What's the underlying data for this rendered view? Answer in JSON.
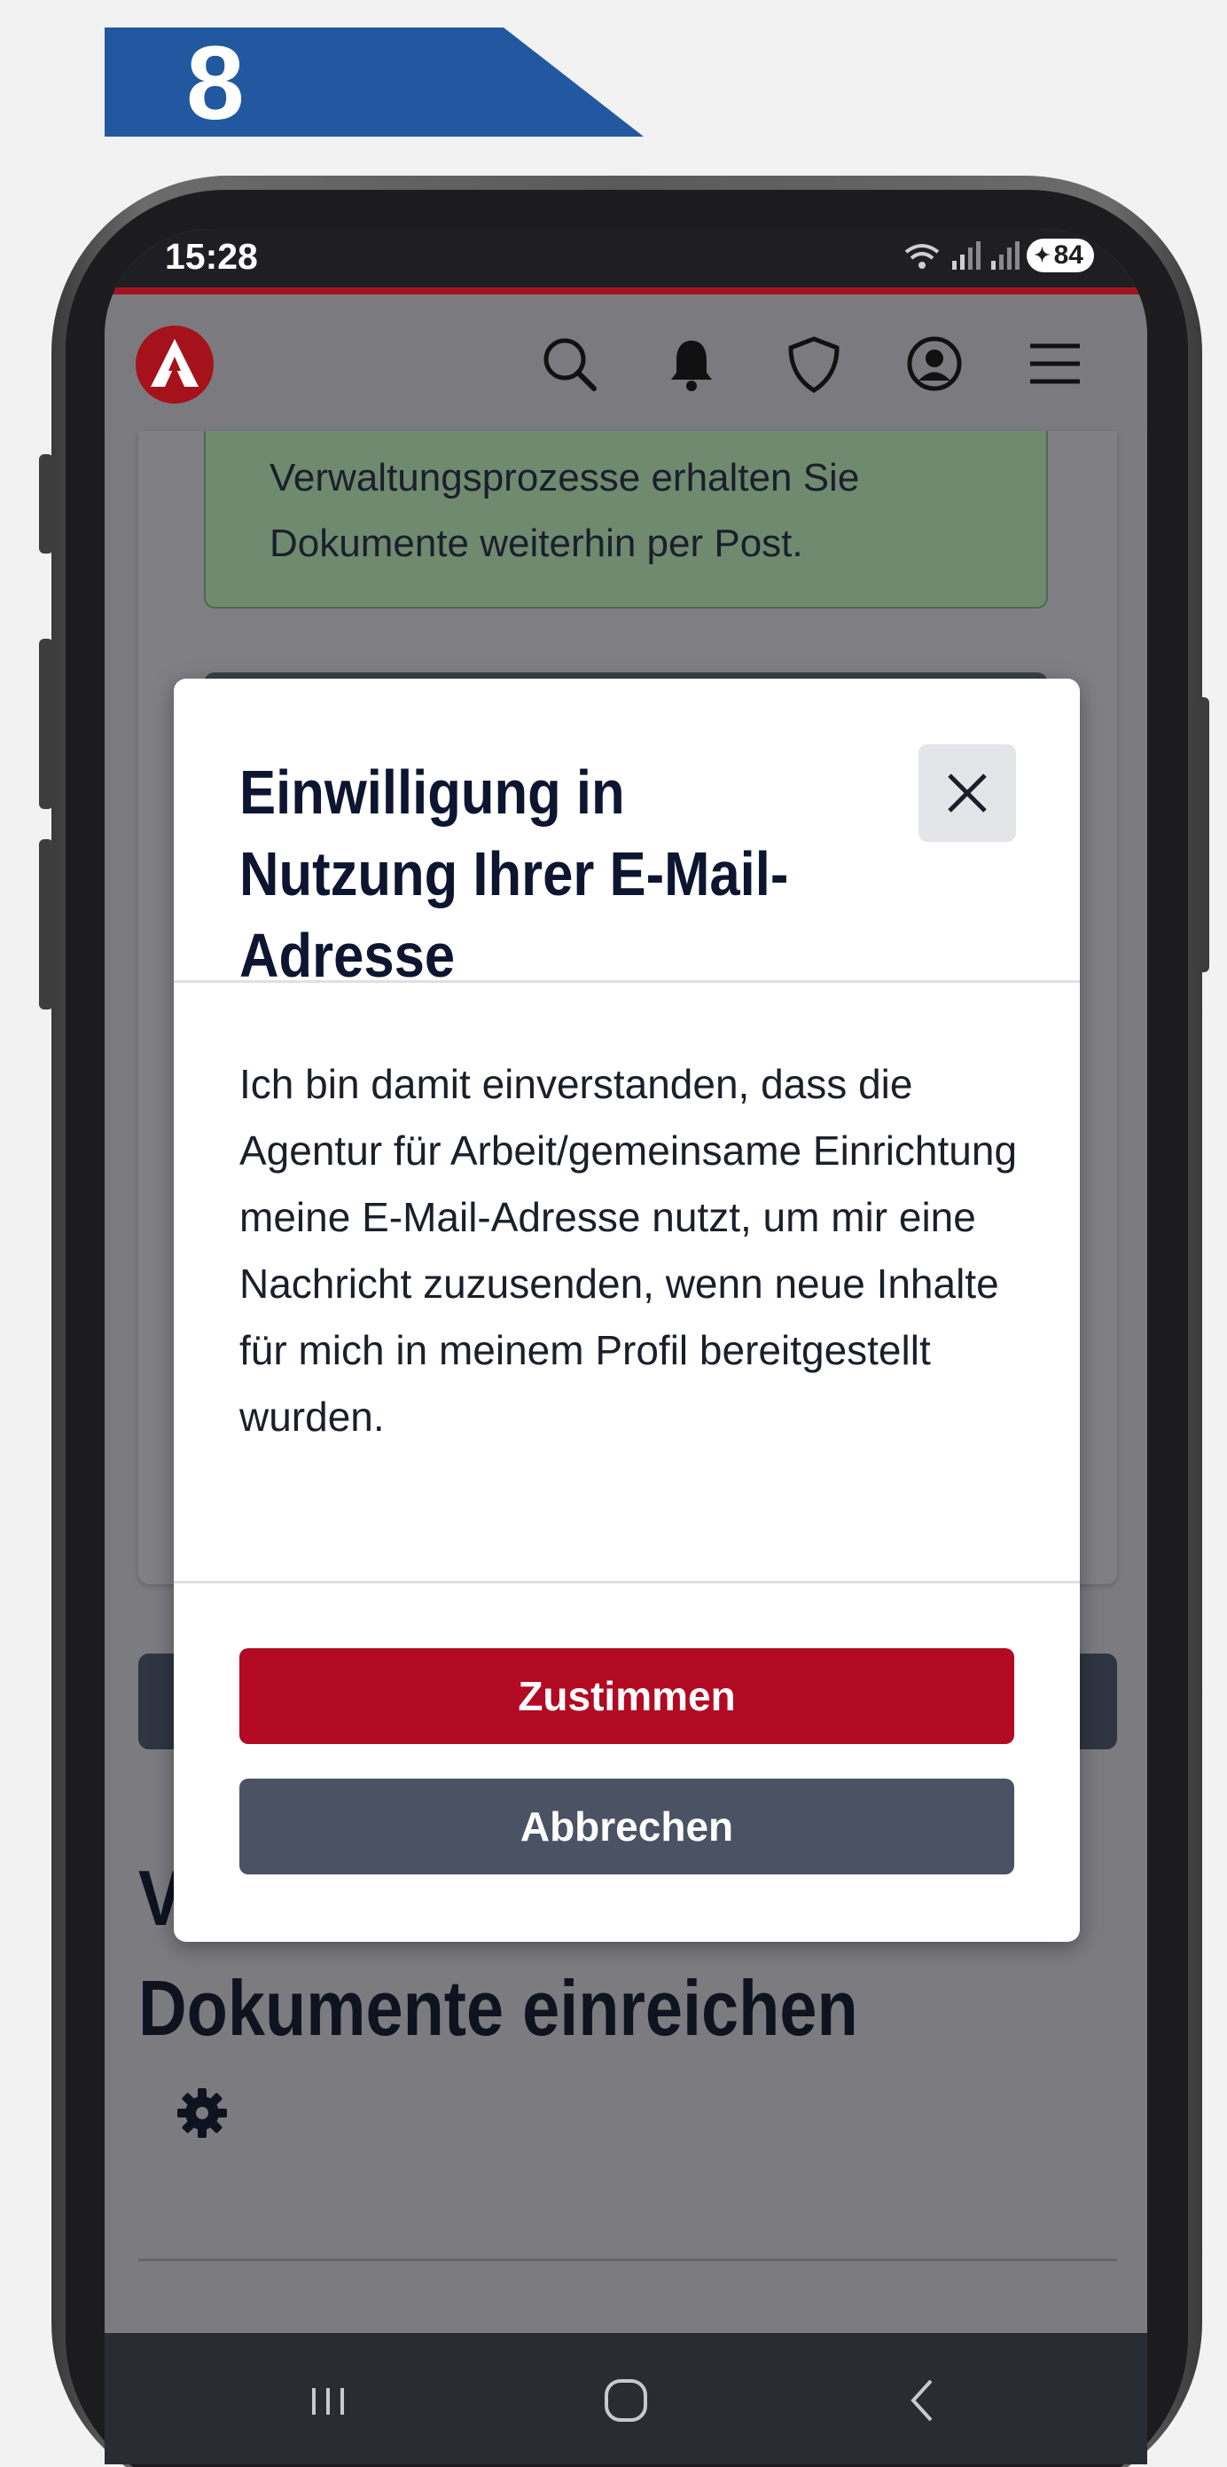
{
  "step": {
    "number": "8",
    "color": "#22589f"
  },
  "status_bar": {
    "time": "15:28",
    "battery": "84"
  },
  "header": {
    "icons": [
      "search-icon",
      "bell-icon",
      "shield-icon",
      "account-icon",
      "menu-icon"
    ]
  },
  "background": {
    "notice_text": "Verwaltungsprozesse erhalten Sie Dokumente weiterhin per Post.",
    "heading": "Weitere Dokumente einreichen",
    "heading_visible_line1": "V",
    "heading_visible_line2": "Dokumente einreichen"
  },
  "modal": {
    "title": "Einwilligung in Nutzung Ihrer E-Mail-Adresse",
    "body": "Ich bin damit einverstanden, dass die Agentur für Arbeit/gemeinsame Einrichtung meine E-Mail-Adresse nutzt, um mir eine Nachricht zuzusenden, wenn neue Inhalte für mich in meinem Profil bereitgestellt wurden.",
    "accept_label": "Zustimmen",
    "cancel_label": "Abbrechen"
  },
  "colors": {
    "brand_red": "#b10a22",
    "secondary_button": "#4a5264",
    "overlay": "#7b7b80"
  }
}
